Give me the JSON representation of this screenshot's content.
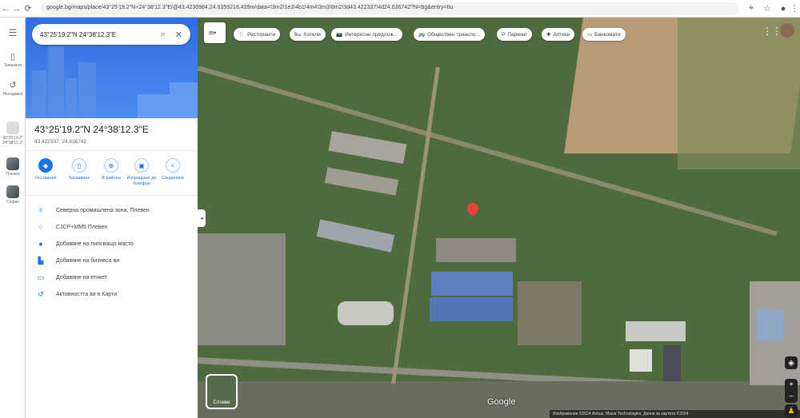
{
  "browser": {
    "url": "google.bg/maps/place/43°25'19.2\"N+24°38'12.3\"E/@43.4230984,24.6359216,439m/data=!3m2!1e3!4b1!4m4!3m3!8m2!3d43.422337!4d24.636742?hl=bg&entry=ttu",
    "back": "←",
    "forward": "→",
    "reload": "⟳"
  },
  "rail": {
    "saved": "Запазени",
    "recent": "Неотдавна",
    "recent_place": "43°25'19.2\" 24°38'12.3\"",
    "place1": "Плевен",
    "place2": "София"
  },
  "search": {
    "value": "43°25'19.2\"N 24°38'12.3\"E"
  },
  "place": {
    "title": "43°25'19.2\"N 24°38'12.3\"E",
    "decimal": "43.422337, 24.636742"
  },
  "actions": [
    {
      "label": "Упътвания"
    },
    {
      "label": "Запазване"
    },
    {
      "label": "В района"
    },
    {
      "label": "Изпращане до телефон"
    },
    {
      "label": "Споделяне"
    }
  ],
  "details": [
    {
      "label": "Северна промишлена зона, Плевен"
    },
    {
      "label": "CJCP+MM5 Плевен"
    },
    {
      "label": "Добавяне на липсващо място"
    },
    {
      "label": "Добавяне на бизнеса ви"
    },
    {
      "label": "Добавяне на етикет"
    },
    {
      "label": "Активността ви в Карти"
    }
  ],
  "chips": [
    {
      "icon": "🍴",
      "label": "Ресторанти"
    },
    {
      "icon": "🛏",
      "label": "Хотели"
    },
    {
      "icon": "📷",
      "label": "Интересни предлож..."
    },
    {
      "icon": "🚌",
      "label": "Обществен транспо..."
    },
    {
      "icon": "P",
      "label": "Паркинг"
    },
    {
      "icon": "✚",
      "label": "Аптеки"
    },
    {
      "icon": "▭",
      "label": "Банкомати"
    }
  ],
  "map": {
    "layers_label": "Слоеве",
    "logo": "Google",
    "pin_color": "#ea4335",
    "attribution": "Изображения ©2024 Airbus, Maxar Technologies, Данни за картата ©2024"
  }
}
